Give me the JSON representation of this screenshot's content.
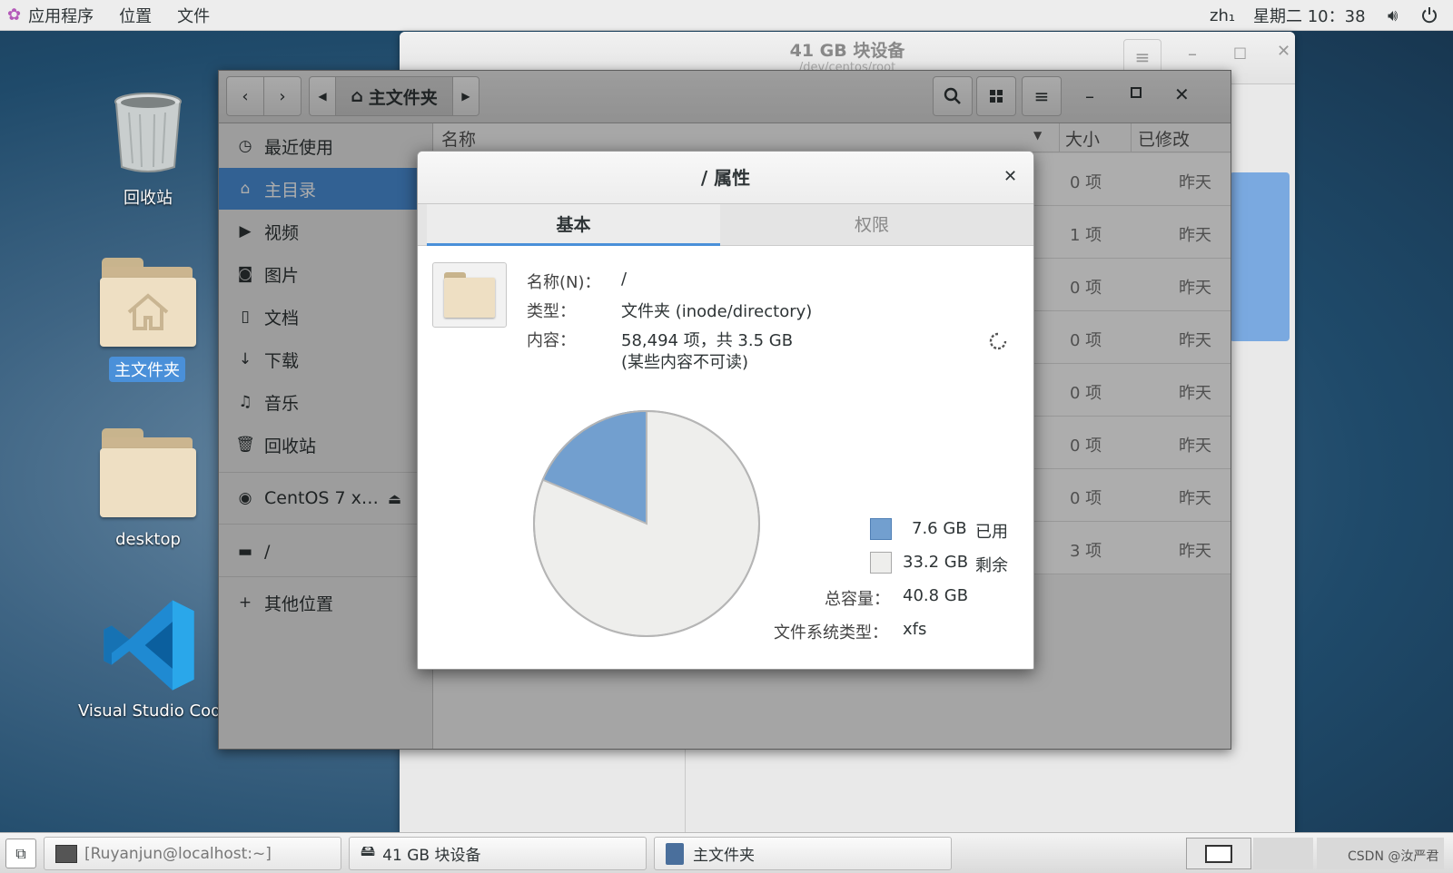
{
  "topbar": {
    "applications": "应用程序",
    "places": "位置",
    "files": "文件",
    "input_method": "zh₁",
    "clock": "星期二 10：38"
  },
  "desktop": {
    "trash_label": "回收站",
    "home_label": "主文件夹",
    "desktop_label": "desktop",
    "vscode_label": "Visual Studio Code"
  },
  "bg_window": {
    "title": "41 GB 块设备",
    "subtitle": "/dev/centos/root"
  },
  "file_manager": {
    "path_label": "主文件夹",
    "sidebar": [
      {
        "label": "最近使用",
        "icon": "clock-icon"
      },
      {
        "label": "主目录",
        "icon": "home-icon"
      },
      {
        "label": "视频",
        "icon": "video-icon"
      },
      {
        "label": "图片",
        "icon": "camera-icon"
      },
      {
        "label": "文档",
        "icon": "document-icon"
      },
      {
        "label": "下载",
        "icon": "download-icon"
      },
      {
        "label": "音乐",
        "icon": "music-icon"
      },
      {
        "label": "回收站",
        "icon": "trash-icon"
      }
    ],
    "device": "CentOS 7 x…",
    "root": "/",
    "other_locations": "其他位置",
    "columns": {
      "name": "名称",
      "size": "大小",
      "modified": "已修改"
    },
    "rows": [
      {
        "size": "0 项",
        "modified": "昨天"
      },
      {
        "size": "1 项",
        "modified": "昨天"
      },
      {
        "size": "0 项",
        "modified": "昨天"
      },
      {
        "size": "0 项",
        "modified": "昨天"
      },
      {
        "size": "0 项",
        "modified": "昨天"
      },
      {
        "size": "0 项",
        "modified": "昨天"
      },
      {
        "size": "0 项",
        "modified": "昨天"
      },
      {
        "size": "3 项",
        "modified": "昨天"
      }
    ]
  },
  "dialog": {
    "title": "/ 属性",
    "tab_basic": "基本",
    "tab_permissions": "权限",
    "name_key": "名称(N)：",
    "name_value": "/",
    "type_key": "类型：",
    "type_value": "文件夹 (inode/directory)",
    "contents_key": "内容：",
    "contents_value": "58,494 项，共 3.5 GB",
    "contents_note": "(某些内容不可读)",
    "used_value": "7.6 GB",
    "used_label": "已用",
    "free_value": "33.2 GB",
    "free_label": "剩余",
    "total_key": "总容量：",
    "total_value": "40.8 GB",
    "fs_key": "文件系统类型：",
    "fs_value": "xfs",
    "used_color": "#729fcf",
    "free_color": "#eeeeec"
  },
  "chart_data": {
    "type": "pie",
    "slices": [
      {
        "label": "已用",
        "value": 7.6
      },
      {
        "label": "剩余",
        "value": 33.2
      }
    ]
  },
  "taskbar": {
    "terminal": "[Ruyanjun@localhost:~]",
    "disk": "41 GB 块设备",
    "files": "主文件夹",
    "watermark": "CSDN @汝严君"
  }
}
